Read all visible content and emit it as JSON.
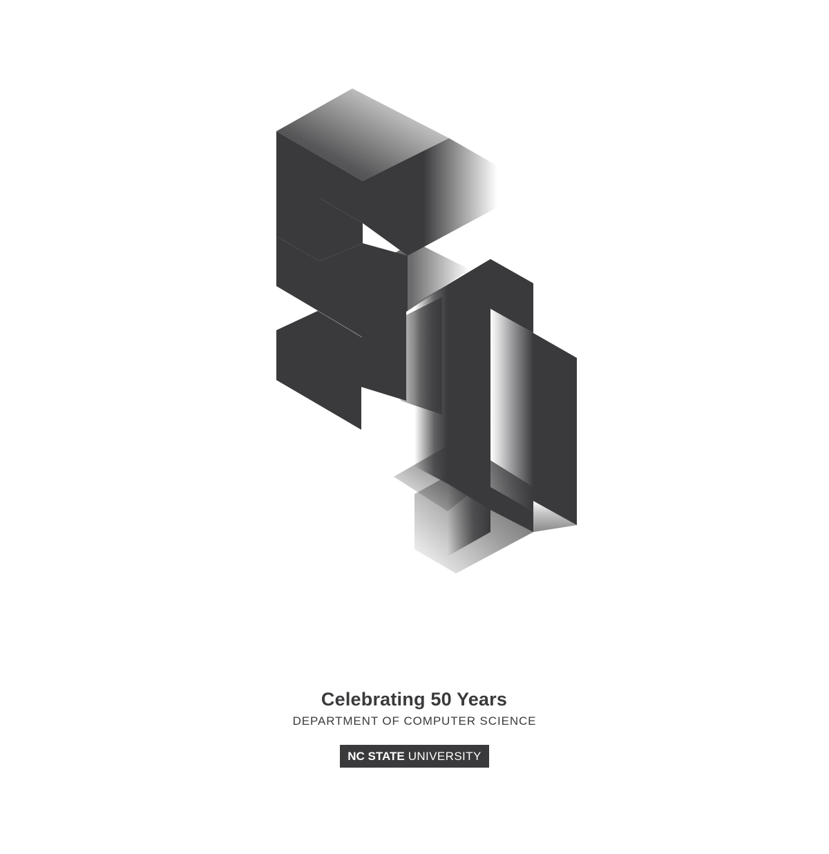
{
  "colors": {
    "background": "#ffffff",
    "ink": "#3a3a3c",
    "badge_text": "#ffffff"
  },
  "artwork": {
    "name": "isometric-50-logo"
  },
  "caption": {
    "title": "Celebrating 50 Years",
    "subtitle": "DEPARTMENT OF COMPUTER SCIENCE"
  },
  "badge": {
    "strong": "NC STATE",
    "light": "UNIVERSITY"
  }
}
